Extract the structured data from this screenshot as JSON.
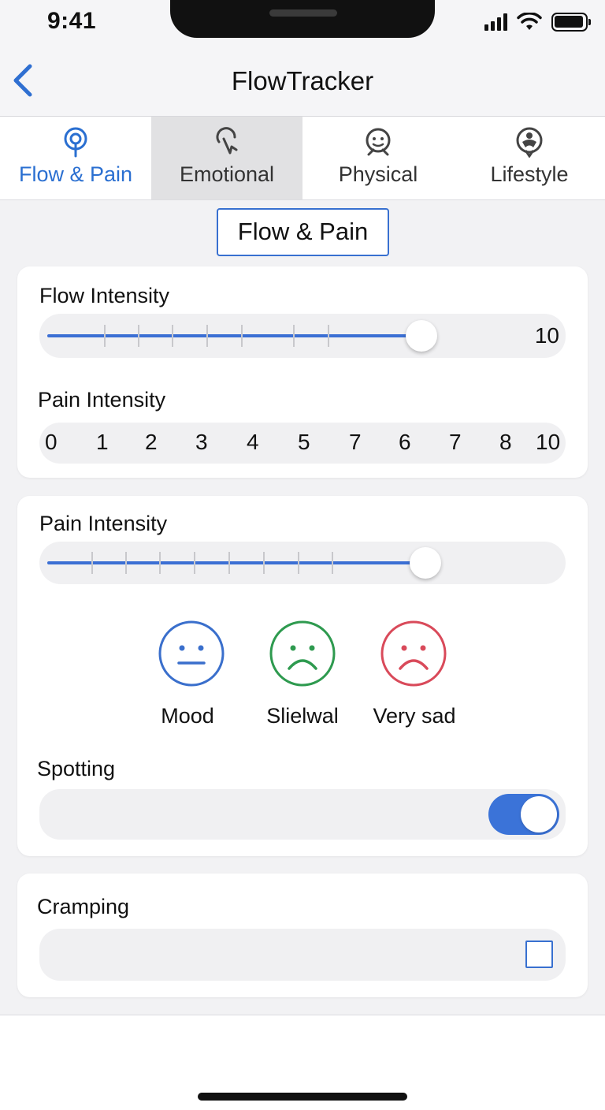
{
  "status_bar": {
    "time": "9:41"
  },
  "nav": {
    "title": "FlowTracker"
  },
  "tabs": [
    {
      "label": "Flow & Pain",
      "icon": "pin-icon"
    },
    {
      "label": "Emotional",
      "icon": "brain-icon"
    },
    {
      "label": "Physical",
      "icon": "face-icon"
    },
    {
      "label": "Lifestyle",
      "icon": "lifestyle-icon"
    }
  ],
  "section": {
    "heading": "Flow & Pain"
  },
  "flow_card": {
    "flow_label": "Flow Intensity",
    "flow_value": "10",
    "pain_label": "Pain Intensity",
    "scale": [
      "0",
      "1",
      "2",
      "3",
      "4",
      "5",
      "7",
      "6",
      "7",
      "8",
      "10"
    ]
  },
  "pain_card": {
    "pain_label": "Pain Intensity",
    "moods": [
      {
        "label": "Mood",
        "color": "#3a6fcc"
      },
      {
        "label": "Slielwal",
        "color": "#2e9a4f"
      },
      {
        "label": "Very sad",
        "color": "#d94a5a"
      }
    ],
    "spotting_label": "Spotting",
    "spotting_on": true
  },
  "cramping_card": {
    "label": "Cramping",
    "checked": false
  },
  "colors": {
    "accent": "#3b6fd4",
    "background": "#f2f2f4"
  }
}
